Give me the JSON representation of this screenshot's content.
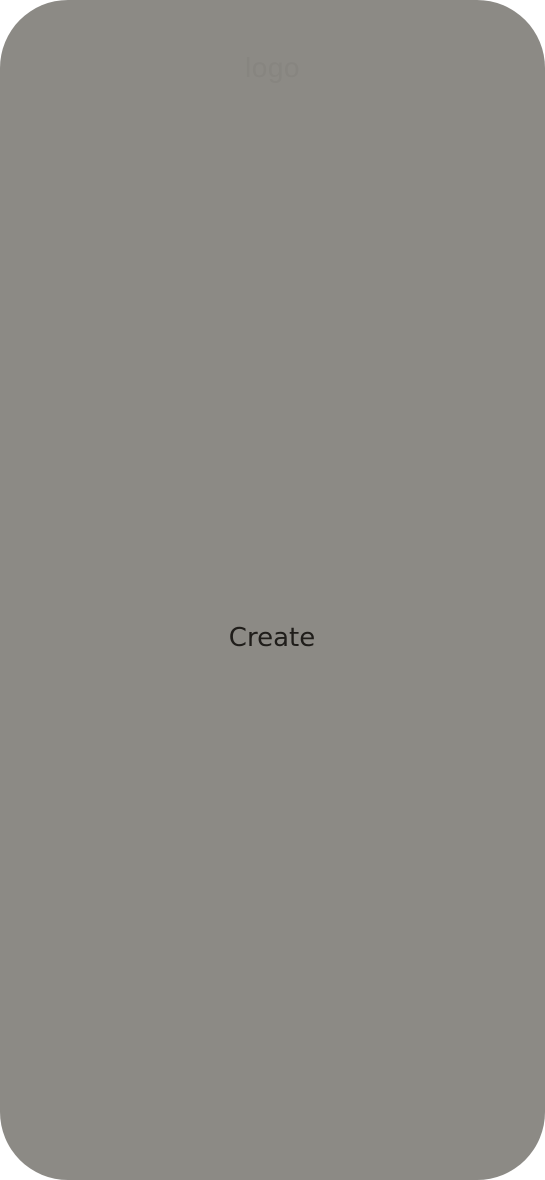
{
  "app": {
    "logo_text": "logo",
    "create_label": "Create"
  },
  "colors": {
    "background": "#8c8a85",
    "logo_text": "#878580",
    "button_text": "#1f1d1a"
  }
}
